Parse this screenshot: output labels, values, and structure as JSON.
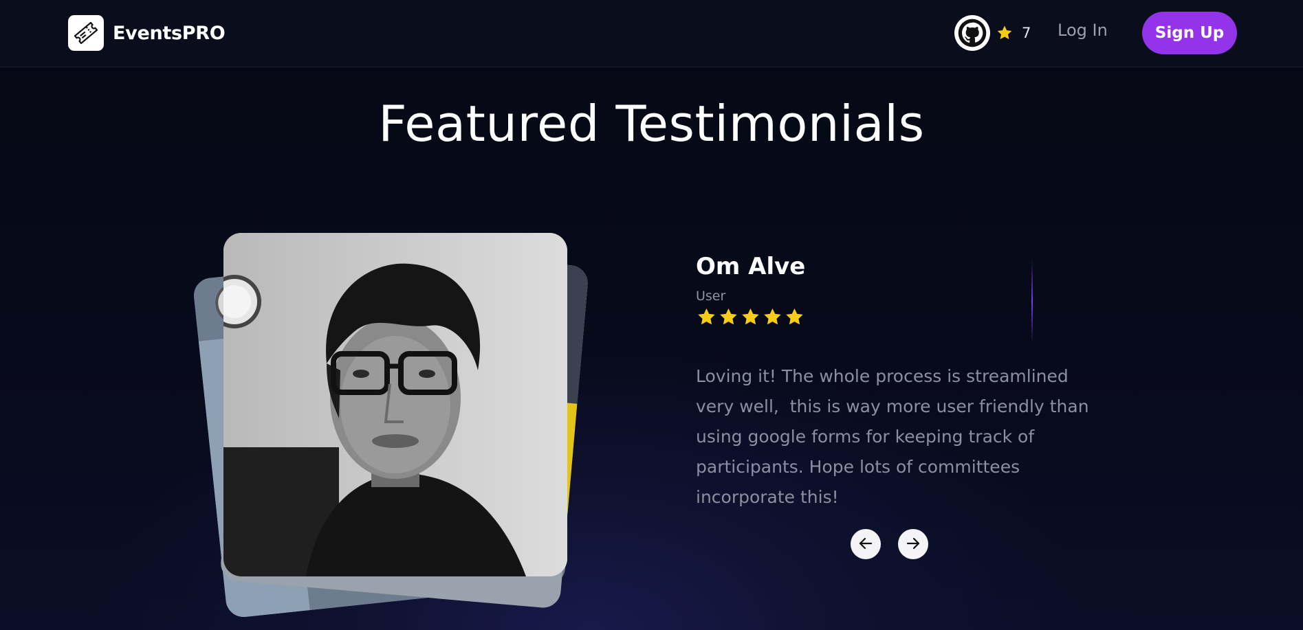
{
  "navbar": {
    "brand": "EventsPRO",
    "github_icon": "github-icon",
    "star_count": "7",
    "login_label": "Log In",
    "signup_label": "Sign Up"
  },
  "page": {
    "heading": "Featured Testimonials"
  },
  "testimonial": {
    "name": "Om Alve",
    "role": "User",
    "rating": 5,
    "quote": "Loving it! The whole process is streamlined very well,  this is way more user friendly than using google forms for keeping track of participants. Hope lots of committees incorporate this!"
  },
  "controls": {
    "prev_icon": "arrow-left-icon",
    "next_icon": "arrow-right-icon"
  },
  "colors": {
    "accent": "#9333ea",
    "star": "#facc15",
    "divider": "#7c3aed",
    "background": "#070a1a"
  }
}
